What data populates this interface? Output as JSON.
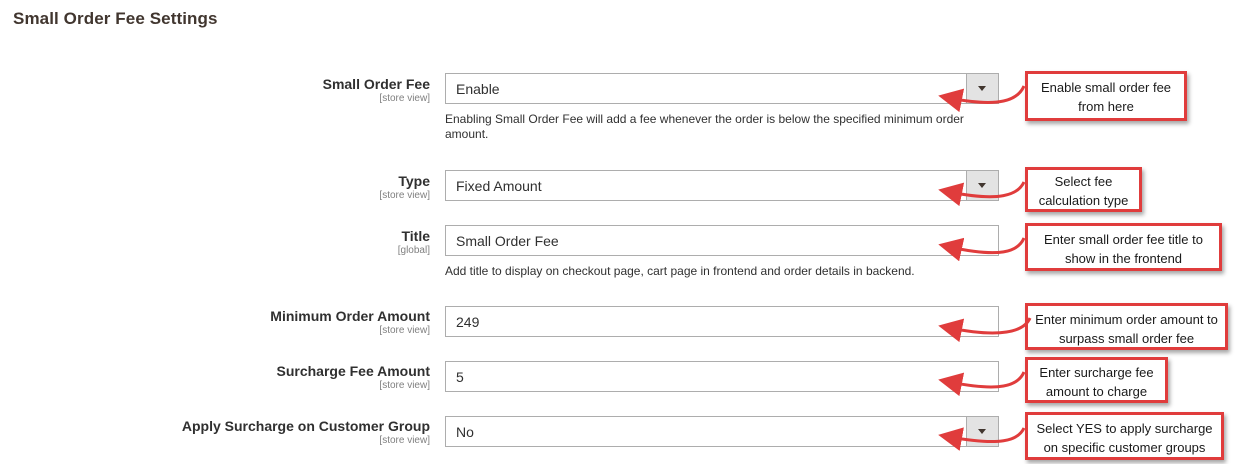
{
  "section": {
    "title": "Small Order Fee Settings"
  },
  "fields": [
    {
      "label": "Small Order Fee",
      "scope": "[store view]",
      "type": "select",
      "value": "Enable",
      "note": "Enabling Small Order Fee will add a fee whenever the order is below the specified minimum order amount."
    },
    {
      "label": "Type",
      "scope": "[store view]",
      "type": "select",
      "value": "Fixed Amount",
      "note": ""
    },
    {
      "label": "Title",
      "scope": "[global]",
      "type": "input",
      "value": "Small Order Fee",
      "note": "Add title to display on checkout page, cart page in frontend and order details in backend."
    },
    {
      "label": "Minimum Order Amount",
      "scope": "[store view]",
      "type": "input",
      "value": "249",
      "note": ""
    },
    {
      "label": "Surcharge Fee Amount",
      "scope": "[store view]",
      "type": "input",
      "value": "5",
      "note": ""
    },
    {
      "label": "Apply Surcharge on Customer Group",
      "scope": "[store view]",
      "type": "select",
      "value": "No",
      "note": ""
    }
  ],
  "callouts": [
    {
      "text": "Enable small order fee from here"
    },
    {
      "text": "Select fee calculation type"
    },
    {
      "text": "Enter small order fee title to show in the frontend"
    },
    {
      "text": "Enter minimum order amount to surpass small order fee"
    },
    {
      "text": "Enter surcharge fee amount to charge"
    },
    {
      "text": "Select YES to apply surcharge on specific customer groups"
    }
  ],
  "colors": {
    "callout_border": "#e03c3c",
    "arrow": "#e03c3c",
    "select_arrow_bg": "#e3e3e3",
    "input_border": "#adadad"
  }
}
